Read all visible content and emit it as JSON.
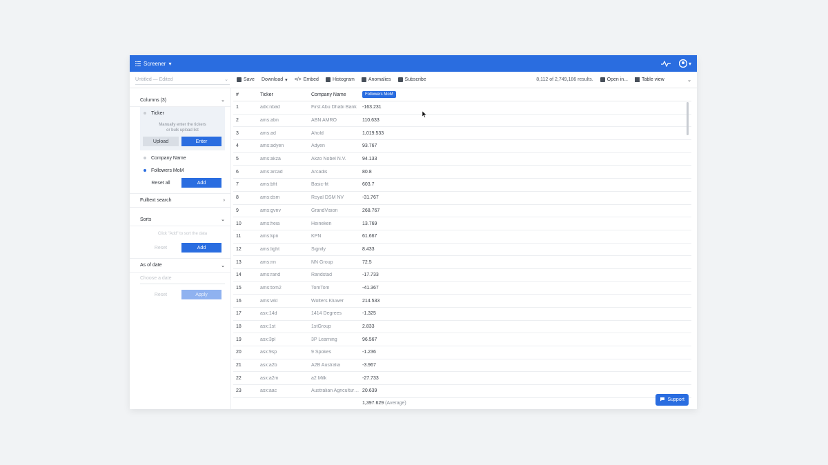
{
  "topbar": {
    "app_name": "Screener"
  },
  "toolbar": {
    "title": "Untitled — Edited",
    "save": "Save",
    "download": "Download",
    "embed": "Embed",
    "histogram": "Histogram",
    "anomalies": "Anomalies",
    "subscribe": "Subscribe",
    "results": "8,112 of 2,749,186 results.",
    "open_in": "Open in...",
    "view": "Table view"
  },
  "sidebar": {
    "columns_title": "Columns (3)",
    "ticker_label": "Ticker",
    "ticker_hint_1": "Manually enter the tickers",
    "ticker_hint_2": "or bulk upload list",
    "upload": "Upload",
    "enter": "Enter",
    "company_label": "Company Name",
    "followers_label": "Followers MoM",
    "reset_all": "Reset all",
    "add": "Add",
    "fulltext": "Fulltext search",
    "sorts_title": "Sorts",
    "sorts_hint": "Click \"Add\" to sort the data",
    "sorts_reset": "Reset",
    "sorts_add": "Add",
    "date_title": "As of date",
    "date_placeholder": "Choose a date",
    "date_reset": "Reset",
    "date_apply": "Apply"
  },
  "table": {
    "headers": [
      "#",
      "Ticker",
      "Company Name",
      "Followers MoM"
    ],
    "rows": [
      [
        "1",
        "adx:nbad",
        "First Abu Dhabi Bank",
        "-163.231"
      ],
      [
        "2",
        "ams:abn",
        "ABN AMRO",
        "110.633"
      ],
      [
        "3",
        "ams:ad",
        "Ahold",
        "1,019.533"
      ],
      [
        "4",
        "ams:adyen",
        "Adyen",
        "93.767"
      ],
      [
        "5",
        "ams:akza",
        "Akzo Nobel N.V.",
        "94.133"
      ],
      [
        "6",
        "ams:arcad",
        "Arcadis",
        "80.8"
      ],
      [
        "7",
        "ams:bfit",
        "Basic-fit",
        "603.7"
      ],
      [
        "8",
        "ams:dsm",
        "Royal DSM NV",
        "-31.767"
      ],
      [
        "9",
        "ams:gvnv",
        "GrandVision",
        "268.767"
      ],
      [
        "10",
        "ams:heia",
        "Heineken",
        "13.769"
      ],
      [
        "11",
        "ams:kpn",
        "KPN",
        "61.667"
      ],
      [
        "12",
        "ams:light",
        "Signify",
        "8.433"
      ],
      [
        "13",
        "ams:nn",
        "NN Group",
        "72.5"
      ],
      [
        "14",
        "ams:rand",
        "Randstad",
        "-17.733"
      ],
      [
        "15",
        "ams:tom2",
        "TomTom",
        "-41.367"
      ],
      [
        "16",
        "ams:wkl",
        "Wolters Kluwer",
        "214.533"
      ],
      [
        "17",
        "asx:14d",
        "1414 Degrees",
        "-1.325"
      ],
      [
        "18",
        "asx:1st",
        "1stGroup",
        "2.833"
      ],
      [
        "19",
        "asx:3pl",
        "3P Learning",
        "96.567"
      ],
      [
        "20",
        "asx:9sp",
        "9 Spokes",
        "-1.236"
      ],
      [
        "21",
        "asx:a2b",
        "A2B Australia",
        "-3.967"
      ],
      [
        "22",
        "asx:a2m",
        "a2 Milk",
        "-27.733"
      ],
      [
        "23",
        "asx:aac",
        "Australian Agricultural Company",
        "20.639"
      ]
    ],
    "footer_value": "1,397.629",
    "footer_label": "(Average)"
  },
  "support": "Support"
}
